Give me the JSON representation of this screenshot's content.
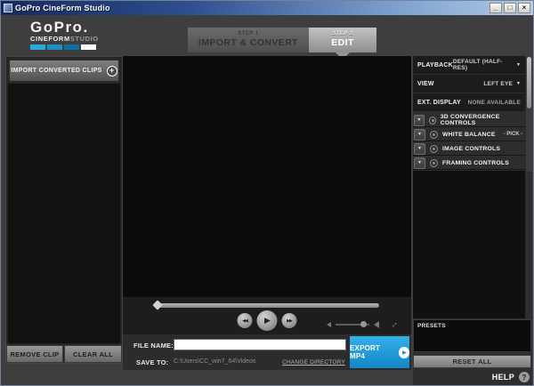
{
  "window": {
    "title": "GoPro CineForm Studio"
  },
  "icons": {
    "minimize": "_",
    "maximize": "□",
    "close": "×",
    "plus": "+",
    "dropdown": "▼",
    "rewind": "◀◀",
    "play": "▶",
    "forward": "▶▶",
    "fullscreen": "↔",
    "help": "?"
  },
  "logo": {
    "brand": "GoPro.",
    "cineform": "CINEFORM",
    "studio": "STUDIO"
  },
  "tabs": [
    {
      "step": "STEP 1",
      "label": "IMPORT & CONVERT",
      "active": false
    },
    {
      "step": "STEP 2",
      "label": "EDIT",
      "active": true
    }
  ],
  "left_panel": {
    "import_button": "IMPORT CONVERTED CLIPS",
    "remove_clip": "REMOVE CLIP",
    "clear_all": "CLEAR ALL"
  },
  "export_bar": {
    "file_name_label": "FILE NAME:",
    "file_name_value": "",
    "save_to_label": "SAVE TO:",
    "save_to_path": "C:\\Users\\CC_win7_64\\Videos",
    "change_directory": "CHANGE DIRECTORY",
    "export_button": "EXPORT MP4"
  },
  "right_panel": {
    "settings": [
      {
        "label": "PLAYBACK",
        "value": "DEFAULT (HALF-RES)",
        "dropdown": true
      },
      {
        "label": "VIEW",
        "value": "LEFT EYE",
        "dropdown": true
      },
      {
        "label": "EXT. DISPLAY",
        "value": "NONE AVAILABLE",
        "dropdown": false
      }
    ],
    "groups": [
      {
        "label": "3D CONVERGENCE CONTROLS"
      },
      {
        "label": "WHITE BALANCE",
        "action": "- PICK -"
      },
      {
        "label": "IMAGE CONTROLS"
      },
      {
        "label": "FRAMING CONTROLS"
      }
    ],
    "presets_label": "PRESETS",
    "reset_all": "RESET ALL"
  },
  "help": {
    "label": "HELP"
  },
  "colors": {
    "accent_blue": "#1c9ad6",
    "export_button_blue": "#1e9bd7",
    "logo_blocks": [
      "#2aa9e0",
      "#1b8fc7",
      "#0f6f9e",
      "#ffffff"
    ]
  }
}
